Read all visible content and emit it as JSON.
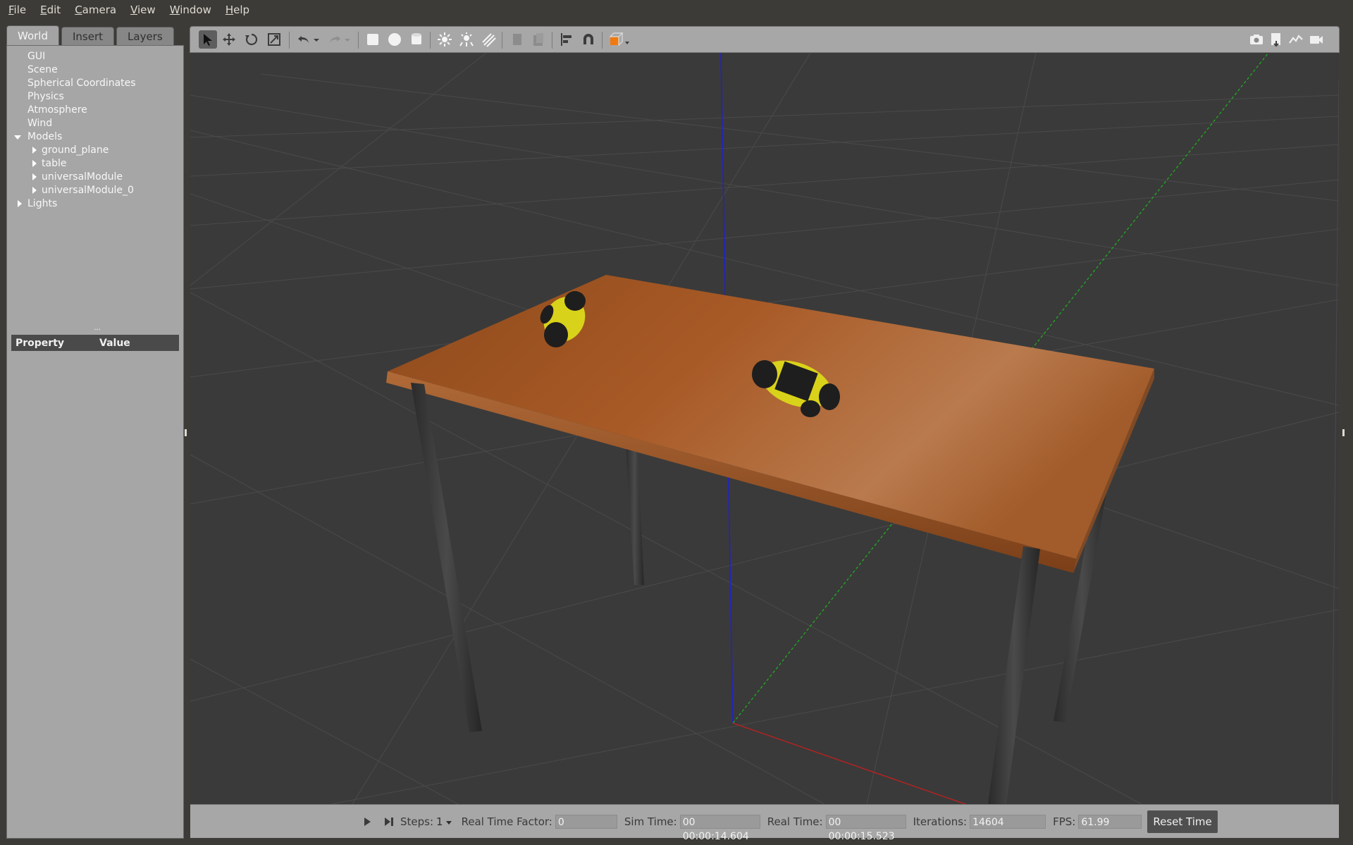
{
  "menu": [
    "File",
    "Edit",
    "Camera",
    "View",
    "Window",
    "Help"
  ],
  "left_panel": {
    "tabs": [
      "World",
      "Insert",
      "Layers"
    ],
    "tree": {
      "gui": "GUI",
      "scene": "Scene",
      "spherical": "Spherical Coordinates",
      "physics": "Physics",
      "atmosphere": "Atmosphere",
      "wind": "Wind",
      "models": "Models",
      "model_items": [
        "ground_plane",
        "table",
        "universalModule",
        "universalModule_0"
      ],
      "lights": "Lights"
    },
    "property_header": {
      "property": "Property",
      "value": "Value"
    }
  },
  "toolbar": {
    "icons": [
      "select-mode-icon",
      "translate-mode-icon",
      "rotate-mode-icon",
      "scale-mode-icon",
      "undo-icon",
      "redo-icon",
      "box-icon",
      "sphere-icon",
      "cylinder-icon",
      "point-light-icon",
      "spot-light-icon",
      "directional-light-icon",
      "copy-icon",
      "paste-icon",
      "align-icon",
      "snap-icon",
      "view-angle-icon",
      "screenshot-icon",
      "log-icon",
      "plot-icon",
      "video-record-icon"
    ]
  },
  "bottom_bar": {
    "steps_label": "Steps:",
    "steps_value": "1",
    "rtf_label": "Real Time Factor:",
    "rtf_value": "0",
    "sim_time_label": "Sim Time:",
    "sim_time_value": "00 00:00:14.604",
    "real_time_label": "Real Time:",
    "real_time_value": "00 00:00:15.523",
    "iterations_label": "Iterations:",
    "iterations_value": "14604",
    "fps_label": "FPS:",
    "fps_value": "61.99",
    "reset_label": "Reset Time"
  },
  "colors": {
    "window_bg": "#3c3b37",
    "panel_bg": "#a6a6a6",
    "viewport_bg": "#3a3a3a",
    "table_wood": "#a65a23",
    "module_yellow": "#d9d21a",
    "axis_x": "#c0201e",
    "axis_y": "#22aa22",
    "axis_z": "#2020d0"
  }
}
